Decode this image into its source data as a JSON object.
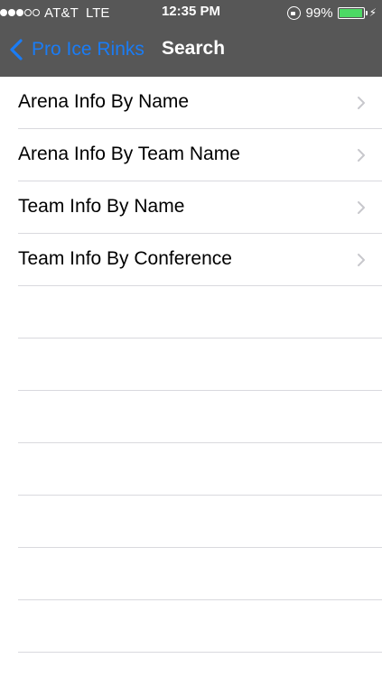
{
  "status_bar": {
    "carrier": "AT&T",
    "network": "LTE",
    "time": "12:35 PM",
    "battery_percent": "99%",
    "battery_level": 0.99,
    "signal_bars_filled": 3,
    "signal_bars_total": 5
  },
  "nav": {
    "back_label": "Pro Ice Rinks",
    "title": "Search"
  },
  "menu": {
    "items": [
      {
        "label": "Arena Info By Name"
      },
      {
        "label": "Arena Info By Team Name"
      },
      {
        "label": "Team Info By Name"
      },
      {
        "label": "Team Info By Conference"
      }
    ]
  },
  "colors": {
    "nav_background": "#575757",
    "accent": "#1a7cf5",
    "battery": "#4cd964",
    "separator": "#d9d9de"
  }
}
